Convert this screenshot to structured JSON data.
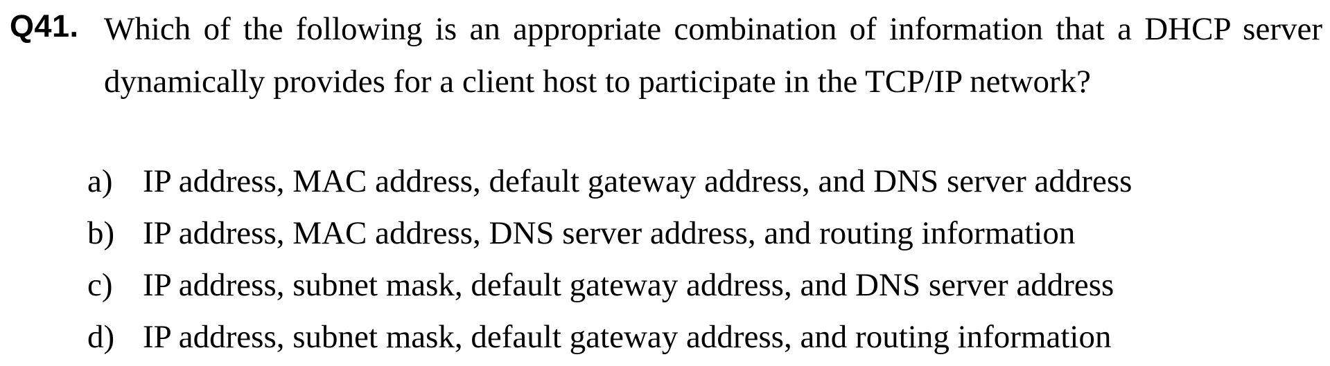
{
  "question": {
    "number": "Q41.",
    "text": "Which of the following is an appropriate combination of information that a DHCP server dynamically provides for a client host to participate in the TCP/IP network?"
  },
  "options": [
    {
      "letter": "a)",
      "text": "IP address, MAC address, default gateway address, and DNS server address"
    },
    {
      "letter": "b)",
      "text": "IP address, MAC address, DNS server address, and routing information"
    },
    {
      "letter": "c)",
      "text": "IP address, subnet mask, default gateway address, and DNS server address"
    },
    {
      "letter": "d)",
      "text": "IP address, subnet mask, default gateway address, and routing information"
    }
  ]
}
